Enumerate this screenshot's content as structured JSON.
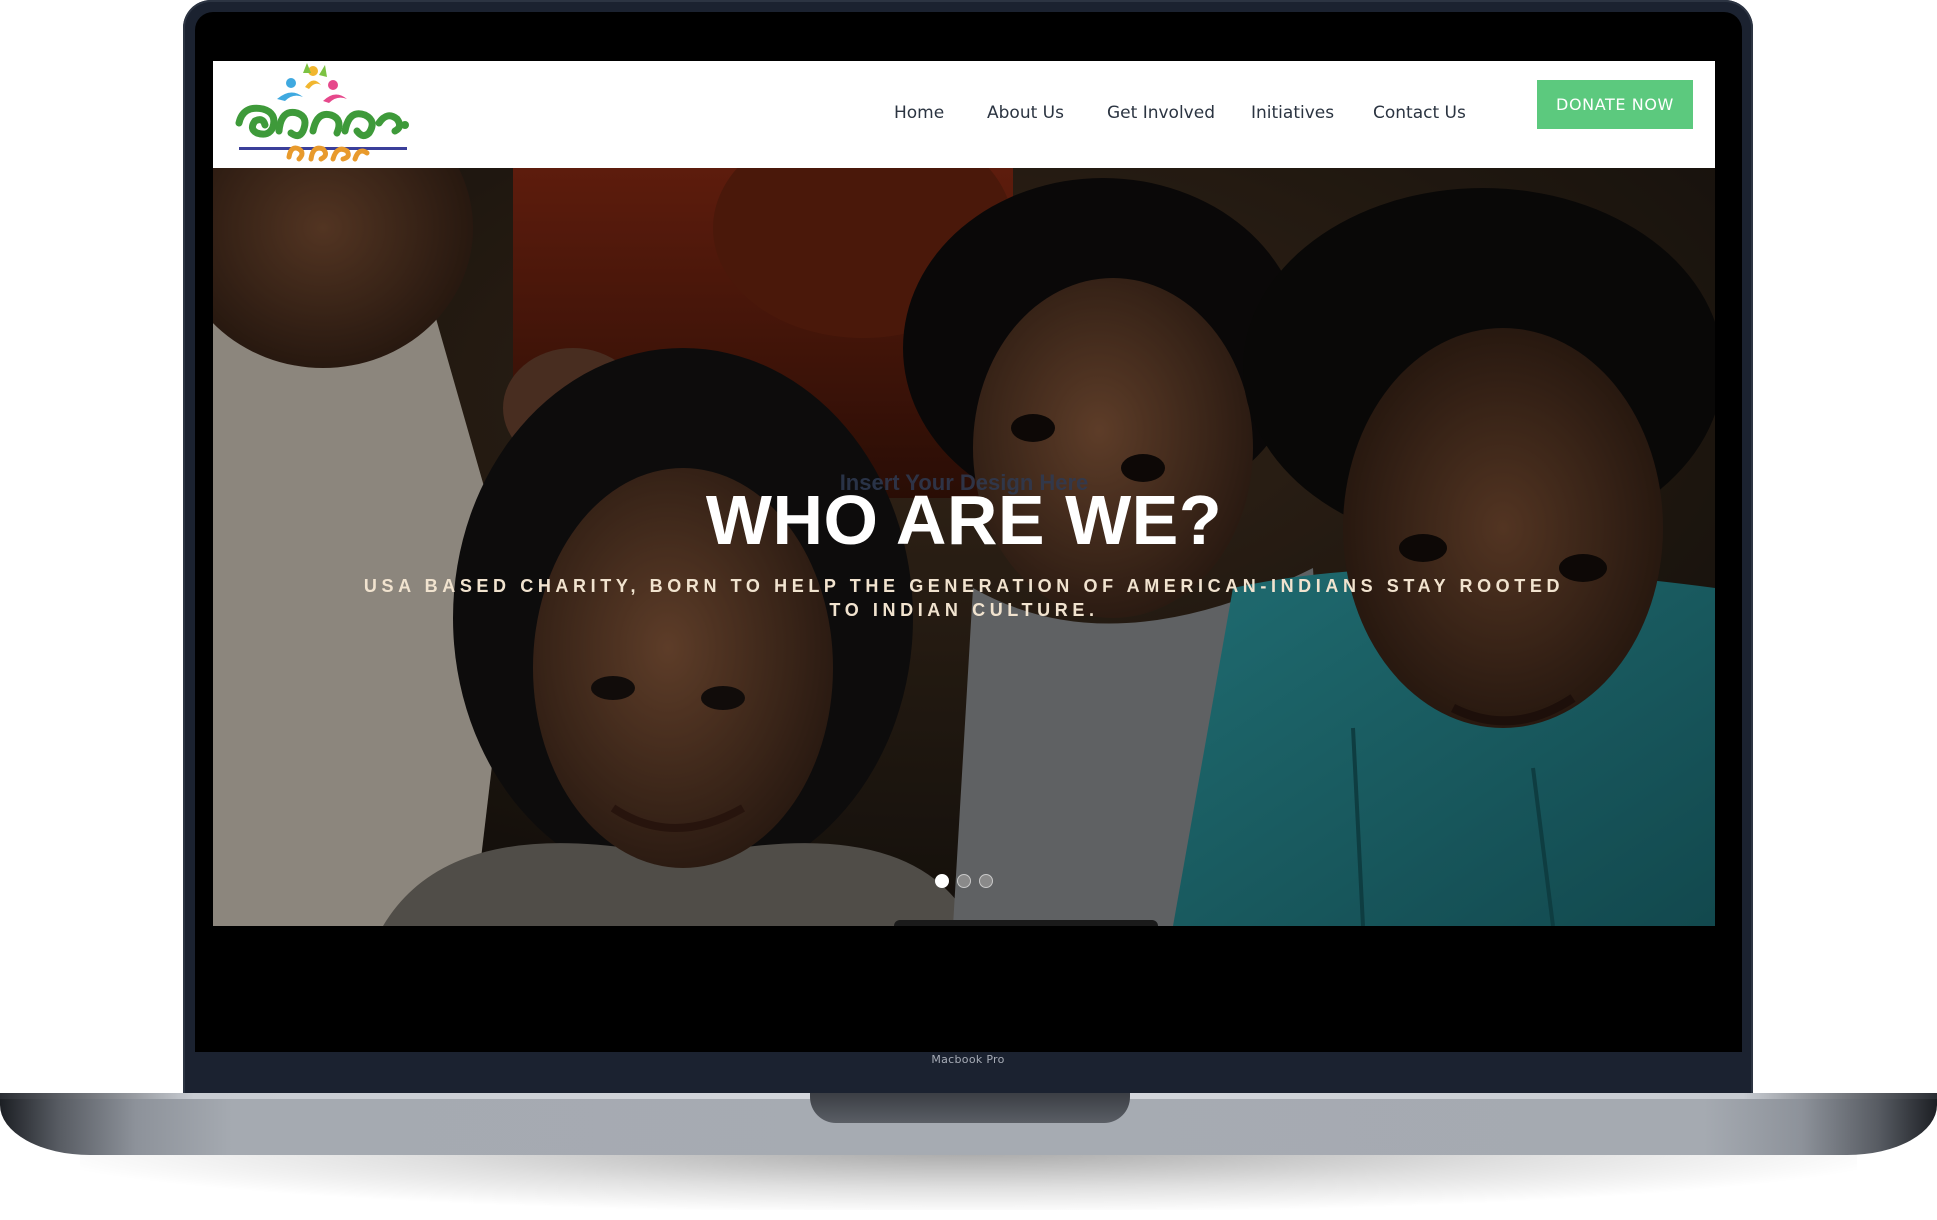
{
  "device": {
    "label": "Macbook Pro"
  },
  "site": {
    "logo": {
      "icon": "charity-people-logo-icon",
      "primary_color": "#4aa64a",
      "secondary_color": "#e89a2c"
    },
    "nav": {
      "items": [
        {
          "label": "Home"
        },
        {
          "label": "About Us"
        },
        {
          "label": "Get Involved"
        },
        {
          "label": "Initiatives"
        },
        {
          "label": "Contact Us"
        }
      ],
      "cta_label": "DONATE NOW",
      "cta_color": "#5cc97e"
    },
    "hero": {
      "eyebrow": "Insert Your Design Here",
      "title": "WHO ARE WE?",
      "subtitle": "USA BASED CHARITY, BORN TO HELP THE GENERATION OF AMERICAN-INDIANS STAY ROOTED TO INDIAN CULTURE.",
      "image": "children-smiling-photo",
      "slider": {
        "slide_count": 3,
        "active_index": 0
      }
    }
  },
  "colors": {
    "nav_text": "#2b3441",
    "hero_title": "#ffffff",
    "hero_subtitle": "#f1e3cf"
  }
}
